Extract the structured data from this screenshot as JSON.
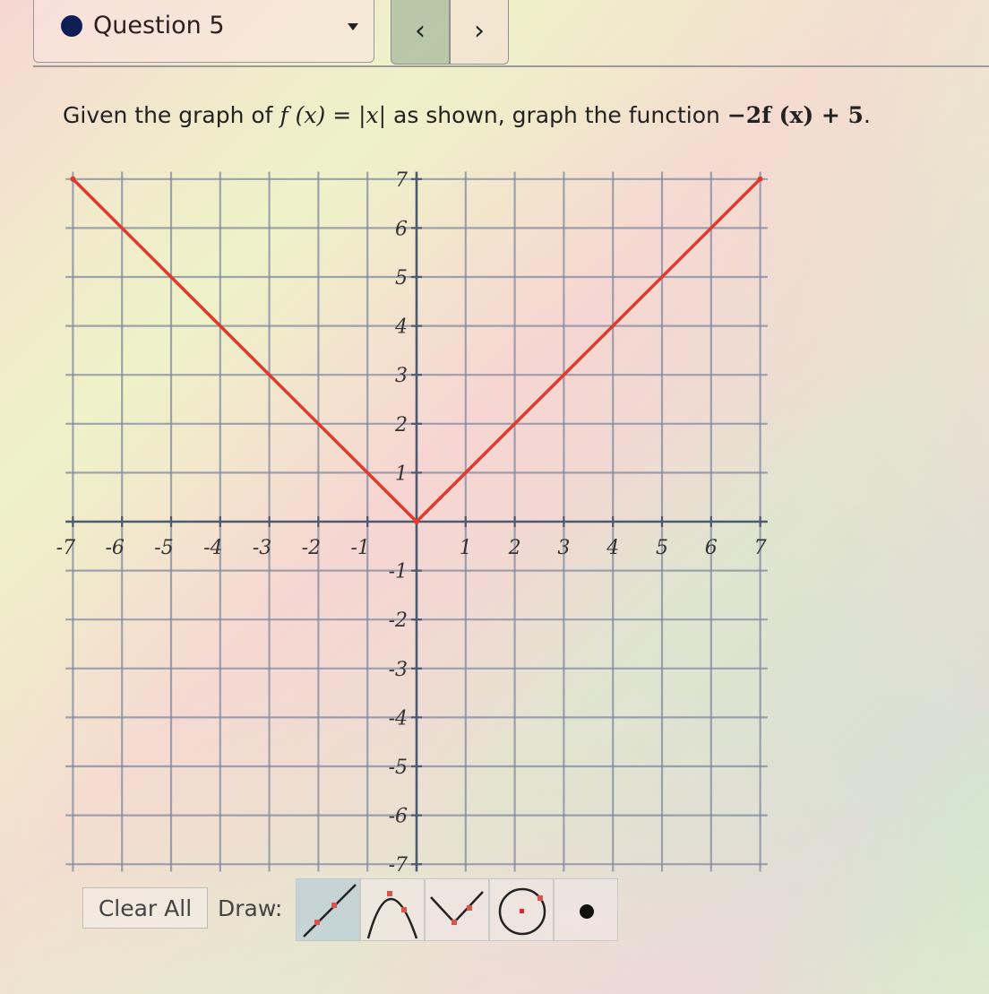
{
  "header": {
    "question_label": "Question 5",
    "question_status_color": "#0f1f55",
    "prev_label": "‹",
    "next_label": "›"
  },
  "prompt": {
    "text_before": "Given the graph of ",
    "f_of_x": "f (x)",
    "equals": " = ",
    "abs_x": "|x|",
    "text_middle": " as shown, graph the function ",
    "target_function": "−2f (x) + 5",
    "text_end": "."
  },
  "toolbar": {
    "clear_label": "Clear All",
    "draw_label": "Draw:",
    "tools": [
      {
        "name": "line",
        "icon": "line-tool-icon",
        "active": true
      },
      {
        "name": "parabola",
        "icon": "parabola-tool-icon",
        "active": false
      },
      {
        "name": "absolute-value",
        "icon": "absolute-value-tool-icon",
        "active": false
      },
      {
        "name": "circle",
        "icon": "circle-tool-icon",
        "active": false
      },
      {
        "name": "point",
        "icon": "point-tool-icon",
        "active": false
      }
    ]
  },
  "chart_data": {
    "type": "line",
    "title": "",
    "xlabel": "",
    "ylabel": "",
    "xlim": [
      -7,
      7
    ],
    "ylim": [
      -7,
      7
    ],
    "grid": true,
    "x_ticks": [
      -7,
      -6,
      -5,
      -4,
      -3,
      -2,
      -1,
      1,
      2,
      3,
      4,
      5,
      6,
      7
    ],
    "y_ticks": [
      -7,
      -6,
      -5,
      -4,
      -3,
      -2,
      -1,
      1,
      2,
      3,
      4,
      5,
      6,
      7
    ],
    "series": [
      {
        "name": "f(x) = |x|",
        "color": "#e03a2a",
        "points": [
          [
            -7,
            7
          ],
          [
            0,
            0
          ],
          [
            7,
            7
          ]
        ]
      }
    ]
  }
}
